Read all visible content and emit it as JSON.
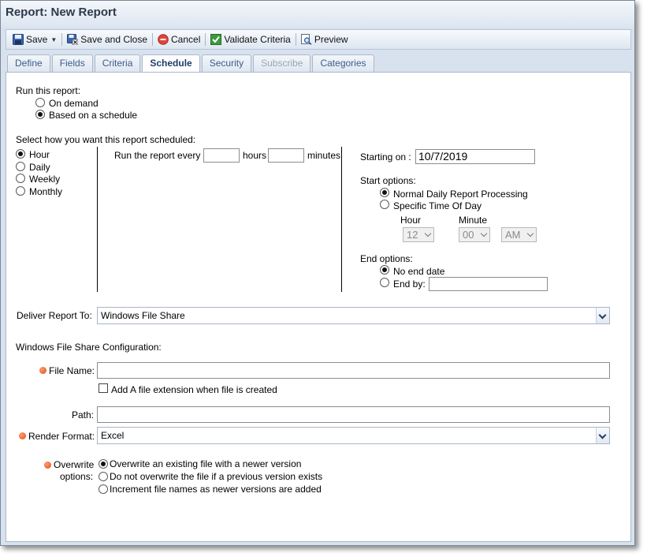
{
  "window": {
    "title": "Report: New Report"
  },
  "toolbar": {
    "save": "Save",
    "save_close": "Save and Close",
    "cancel": "Cancel",
    "validate": "Validate Criteria",
    "preview": "Preview"
  },
  "tabs": [
    {
      "label": "Define",
      "state": "normal"
    },
    {
      "label": "Fields",
      "state": "normal"
    },
    {
      "label": "Criteria",
      "state": "normal"
    },
    {
      "label": "Schedule",
      "state": "active"
    },
    {
      "label": "Security",
      "state": "normal"
    },
    {
      "label": "Subscribe",
      "state": "disabled"
    },
    {
      "label": "Categories",
      "state": "normal"
    }
  ],
  "run": {
    "label": "Run this report:",
    "options": [
      {
        "label": "On demand",
        "selected": false
      },
      {
        "label": "Based on a schedule",
        "selected": true
      }
    ]
  },
  "schedule": {
    "label": "Select how you want this report scheduled:",
    "frequency": [
      {
        "label": "Hour",
        "selected": true
      },
      {
        "label": "Daily",
        "selected": false
      },
      {
        "label": "Weekly",
        "selected": false
      },
      {
        "label": "Monthly",
        "selected": false
      }
    ],
    "every_label": "Run the report every",
    "hours_label": "hours",
    "minutes_label": "minutes",
    "hours_value": "",
    "minutes_value": "",
    "starting_label": "Starting on :",
    "starting_value": "10/7/2019",
    "start_options_label": "Start options:",
    "start_options": [
      {
        "label": "Normal Daily Report Processing",
        "selected": true
      },
      {
        "label": "Specific Time Of Day",
        "selected": false
      }
    ],
    "hour_label": "Hour",
    "minute_label": "Minute",
    "hour_value": "12",
    "minute_value": "00",
    "ampm_value": "AM",
    "end_options_label": "End options:",
    "end_options": [
      {
        "label": "No end date",
        "selected": true
      },
      {
        "label": "End by:",
        "selected": false
      }
    ],
    "end_by_value": ""
  },
  "deliver": {
    "label": "Deliver Report To:",
    "value": "Windows File Share"
  },
  "wfs": {
    "section_label": "Windows File Share Configuration:",
    "file_name_label": "File Name:",
    "file_name_value": "",
    "extension_label": "Add A file extension when file is created",
    "extension_checked": false,
    "path_label": "Path:",
    "path_value": "",
    "render_label": "Render Format:",
    "render_value": "Excel",
    "overwrite_label_1": "Overwrite",
    "overwrite_label_2": "options:",
    "overwrite_options": [
      {
        "label": "Overwrite an existing file with a newer version",
        "selected": true
      },
      {
        "label": "Do not overwrite the file if a previous version exists",
        "selected": false
      },
      {
        "label": "Increment file names as newer versions are added",
        "selected": false
      }
    ]
  },
  "colors": {
    "accent": "#1f3d68",
    "tab_text": "#3a5c8a",
    "required": "#e0501c",
    "panel_bg": "#d8e2ee"
  },
  "icons": {
    "save": "floppy-disk-icon",
    "save_close": "save-close-icon",
    "cancel": "cancel-icon",
    "validate": "check-icon",
    "preview": "preview-icon"
  }
}
